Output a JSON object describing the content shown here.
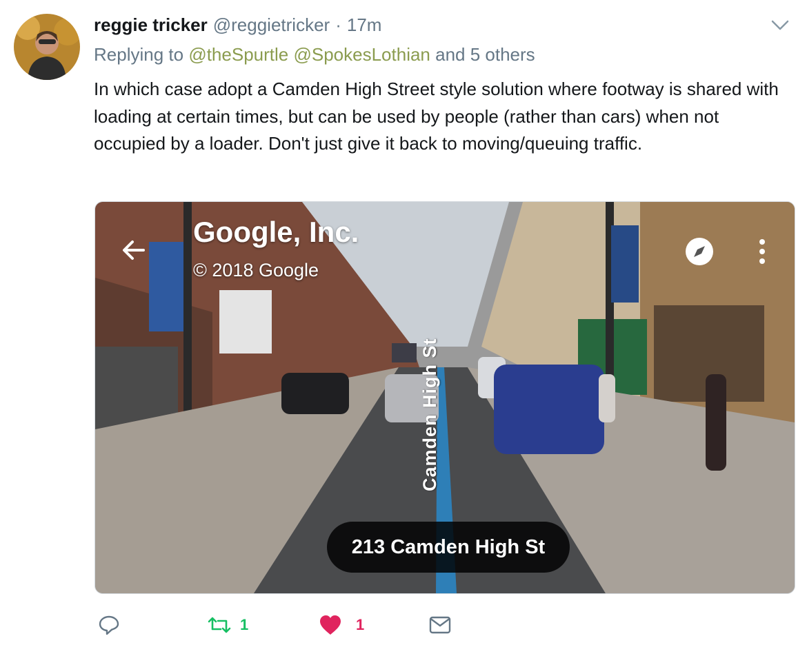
{
  "tweet": {
    "author_name": "reggie tricker",
    "author_handle": "@reggietricker",
    "separator": "·",
    "time": "17m",
    "replying_prefix": "Replying to",
    "mention_1": "@theSpurtle",
    "mention_2": "@SpokesLothian",
    "replying_suffix": "and 5 others",
    "text": "In which case adopt a Camden High Street style solution where footway is shared with loading at certain times, but can be used by people (rather than cars) when not occupied by a loader. Don't just give it back to moving/queuing traffic."
  },
  "media": {
    "title": "Google, Inc.",
    "copyright": "© 2018 Google",
    "address": "213 Camden High St",
    "street_overlay": "Camden High St"
  },
  "actions": {
    "reply_icon": "reply-icon",
    "retweet_icon": "retweet-icon",
    "retweet_count": "1",
    "like_icon": "heart-icon",
    "like_count": "1",
    "dm_icon": "envelope-icon"
  },
  "colors": {
    "mention": "#8b9c4f",
    "retweet": "#17bf63",
    "like": "#e0245e",
    "meta": "#657786"
  }
}
